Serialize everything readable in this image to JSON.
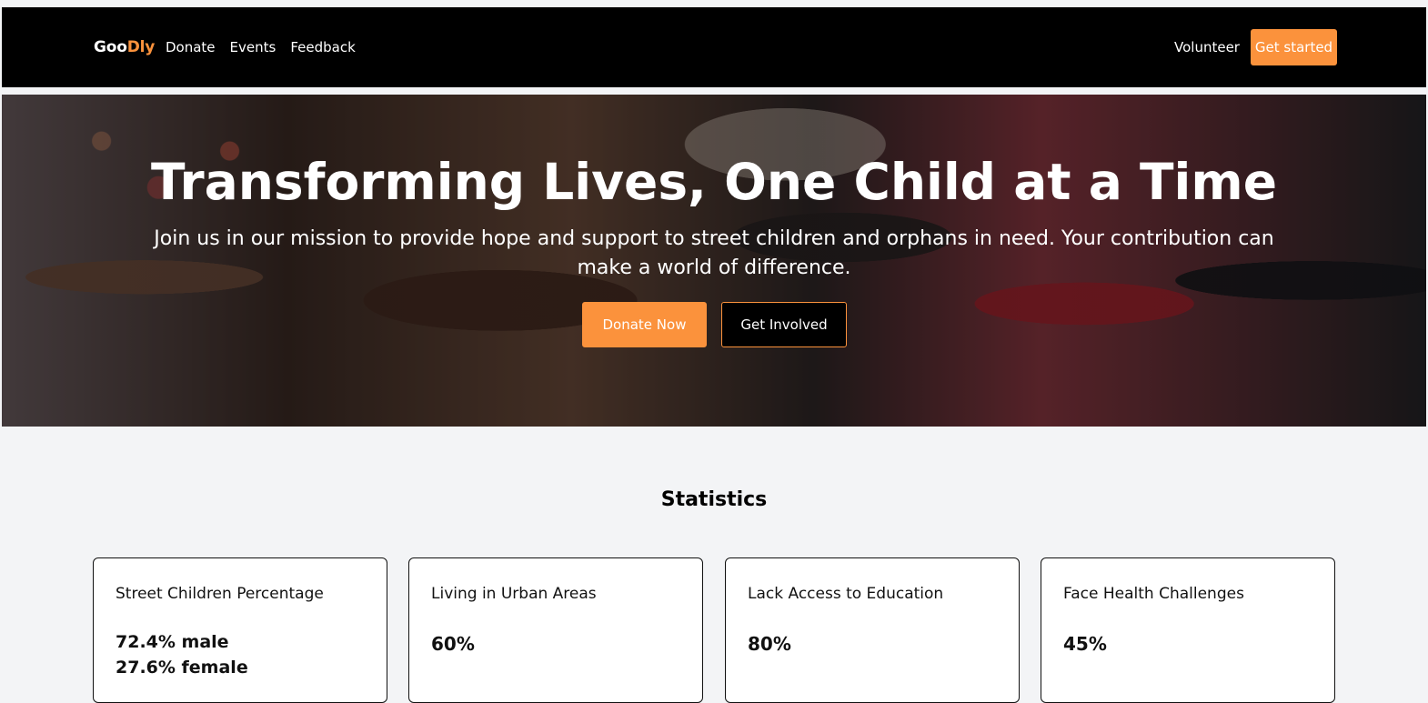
{
  "brand": {
    "prefix": "Goo",
    "accent": "Dly"
  },
  "nav": {
    "links": [
      "Donate",
      "Events",
      "Feedback"
    ],
    "right_link": "Volunteer",
    "cta": "Get started"
  },
  "hero": {
    "title": "Transforming Lives, One Child at a Time",
    "subtitle": "Join us in our mission to provide hope and support to street children and orphans in need. Your contribution can make a world of difference.",
    "primary_button": "Donate Now",
    "secondary_button": "Get Involved"
  },
  "stats": {
    "title": "Statistics",
    "cards": [
      {
        "label": "Street Children Percentage",
        "values": [
          "72.4% male",
          "27.6% female"
        ]
      },
      {
        "label": "Living in Urban Areas",
        "value": "60%"
      },
      {
        "label": "Lack Access to Education",
        "value": "80%"
      },
      {
        "label": "Face Health Challenges",
        "value": "45%"
      }
    ]
  },
  "colors": {
    "accent": "#fb923c",
    "nav_background": "#000000",
    "page_background": "#f3f4f6"
  }
}
